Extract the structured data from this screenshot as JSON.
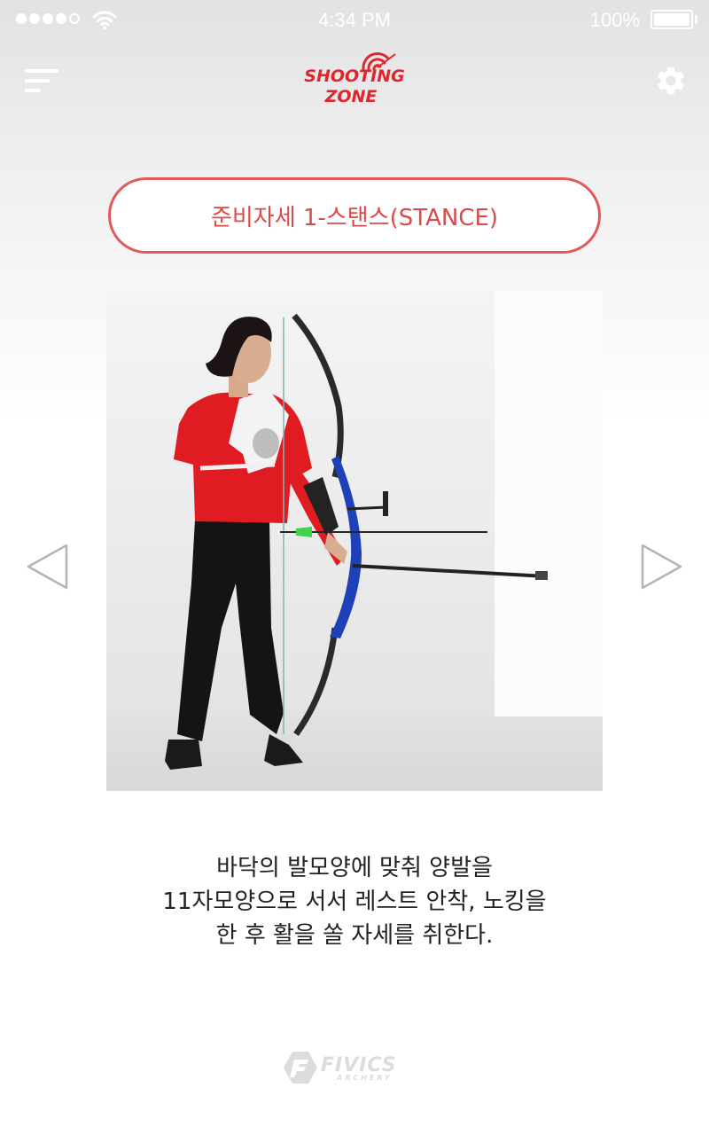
{
  "status_bar": {
    "time": "4:34 PM",
    "battery": "100%",
    "signal_icon": "signal-dots-icon",
    "wifi_icon": "wifi-icon"
  },
  "header": {
    "menu_icon": "hamburger-menu-icon",
    "logo_line1": "SHOOTING",
    "logo_line2": "ZONE",
    "settings_icon": "gear-icon",
    "accent_color": "#e0262d"
  },
  "main": {
    "stance_button_label": "준비자세 1-스탠스(STANCE)",
    "prev_icon": "triangle-left-icon",
    "next_icon": "triangle-right-icon",
    "description_lines": [
      "바닥의 발모양에 맞춰 양발을",
      "11자모양으로 서서 레스트 안착, 노킹을",
      "한 후 활을 쏠 자세를 취한다."
    ]
  },
  "footer": {
    "brand": "FIVICS",
    "brand_sub": "ARCHERY"
  }
}
